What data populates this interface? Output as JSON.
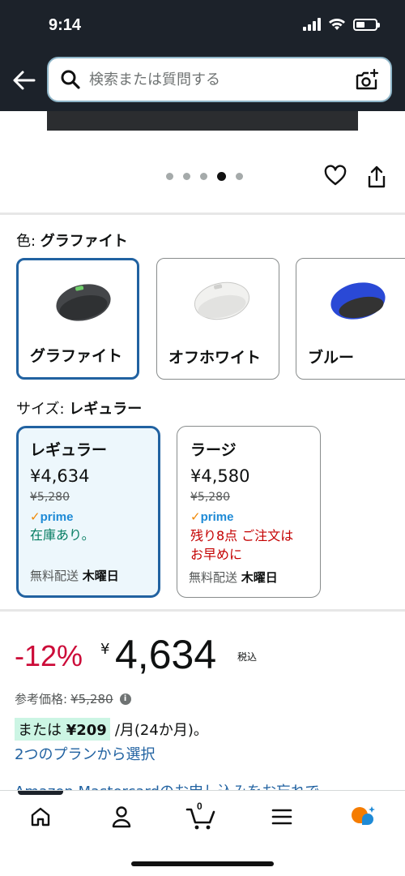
{
  "status_bar": {
    "time": "9:14"
  },
  "search": {
    "placeholder": "検索または質問する"
  },
  "carousel": {
    "dot_count": 5,
    "active_index": 3
  },
  "color": {
    "label": "色: ",
    "selected": "グラファイト",
    "options": [
      {
        "name": "グラファイト",
        "color": "#4a4d50",
        "selected": true
      },
      {
        "name": "オフホワイト",
        "color": "#eeeeec",
        "selected": false
      },
      {
        "name": "ブルー",
        "color": "#2a49d6",
        "selected": false
      }
    ]
  },
  "size": {
    "label": "サイズ: ",
    "selected": "レギュラー",
    "options": [
      {
        "name": "レギュラー",
        "price": "¥4,634",
        "list_price": "¥5,280",
        "prime": "prime",
        "stock": "在庫あり。",
        "shipping_label": "無料配送",
        "shipping_day": "木曜日",
        "selected": true
      },
      {
        "name": "ラージ",
        "price": "¥4,580",
        "list_price": "¥5,280",
        "prime": "prime",
        "stock_line1": "残り8点 ご注文は",
        "stock_line2": "お早めに",
        "shipping_label": "無料配送",
        "shipping_day": "木曜日",
        "selected": false
      }
    ]
  },
  "price": {
    "discount": "-12%",
    "currency": "¥",
    "amount": "4,634",
    "tax_note": "税込",
    "reference_label": "参考価格:",
    "reference_price": "¥5,280",
    "installment_prefix": "または",
    "installment_amount": "¥209",
    "installment_suffix": "/月(24か月)。",
    "plan_link": "2つのプランから選択",
    "mastercard_link": "Amazon Mastercardのお申し込みをお忘れで"
  },
  "bottom_nav": {
    "cart_count": "0"
  },
  "colors": {
    "header_bg": "#1c222a",
    "accent_blue": "#2162a1",
    "discount_red": "#cc0c39",
    "prime_blue": "#1e8ad6",
    "in_stock_green": "#067d62"
  }
}
